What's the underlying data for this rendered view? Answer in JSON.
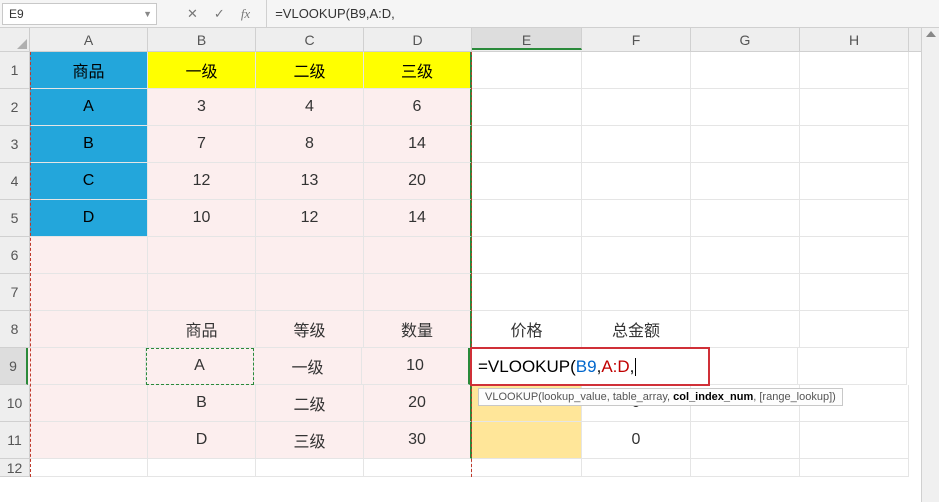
{
  "name_box": "E9",
  "fx_controls": {
    "cancel": "✕",
    "enter": "✓",
    "fx": "fx"
  },
  "formula_bar": "=VLOOKUP(B9,A:D,",
  "columns": [
    "A",
    "B",
    "C",
    "D",
    "E",
    "F",
    "G",
    "H"
  ],
  "rows": [
    "1",
    "2",
    "3",
    "4",
    "5",
    "6",
    "7",
    "8",
    "9",
    "10",
    "11",
    "12"
  ],
  "active_cell": "E9",
  "cells": {
    "A1": "商品",
    "B1": "一级",
    "C1": "二级",
    "D1": "三级",
    "A2": "A",
    "B2": "3",
    "C2": "4",
    "D2": "6",
    "A3": "B",
    "B3": "7",
    "C3": "8",
    "D3": "14",
    "A4": "C",
    "B4": "12",
    "C4": "13",
    "D4": "20",
    "A5": "D",
    "B5": "10",
    "C5": "12",
    "D5": "14",
    "B8": "商品",
    "C8": "等级",
    "D8": "数量",
    "E8": "价格",
    "F8": "总金额",
    "B9": "A",
    "C9": "一级",
    "D9": "10",
    "B10": "B",
    "C10": "二级",
    "D10": "20",
    "F10": "0",
    "B11": "D",
    "C11": "三级",
    "D11": "30",
    "F11": "0"
  },
  "formula_overlay": {
    "prefix": "=VLOOKUP(",
    "arg1": "B9",
    "sep1": ",",
    "arg2": "A:D",
    "sep2": ","
  },
  "tooltip": {
    "fn": "VLOOKUP(",
    "a1": "lookup_value",
    "a2": "table_array",
    "a3": "col_index_num",
    "a4": "[range_lookup]",
    "close": ")"
  },
  "chart_data": {
    "type": "table",
    "primary_table": {
      "columns": [
        "商品",
        "一级",
        "二级",
        "三级"
      ],
      "rows": [
        {
          "商品": "A",
          "一级": 3,
          "二级": 4,
          "三级": 6
        },
        {
          "商品": "B",
          "一级": 7,
          "二级": 8,
          "三级": 14
        },
        {
          "商品": "C",
          "一级": 12,
          "二级": 13,
          "三级": 20
        },
        {
          "商品": "D",
          "一级": 10,
          "二级": 12,
          "三级": 14
        }
      ]
    },
    "lookup_table": {
      "columns": [
        "商品",
        "等级",
        "数量",
        "价格",
        "总金额"
      ],
      "rows": [
        {
          "商品": "A",
          "等级": "一级",
          "数量": 10,
          "价格": "=VLOOKUP(B9,A:D,",
          "总金额": null
        },
        {
          "商品": "B",
          "等级": "二级",
          "数量": 20,
          "价格": null,
          "总金额": 0
        },
        {
          "商品": "D",
          "等级": "三级",
          "数量": 30,
          "价格": null,
          "总金额": 0
        }
      ]
    }
  }
}
